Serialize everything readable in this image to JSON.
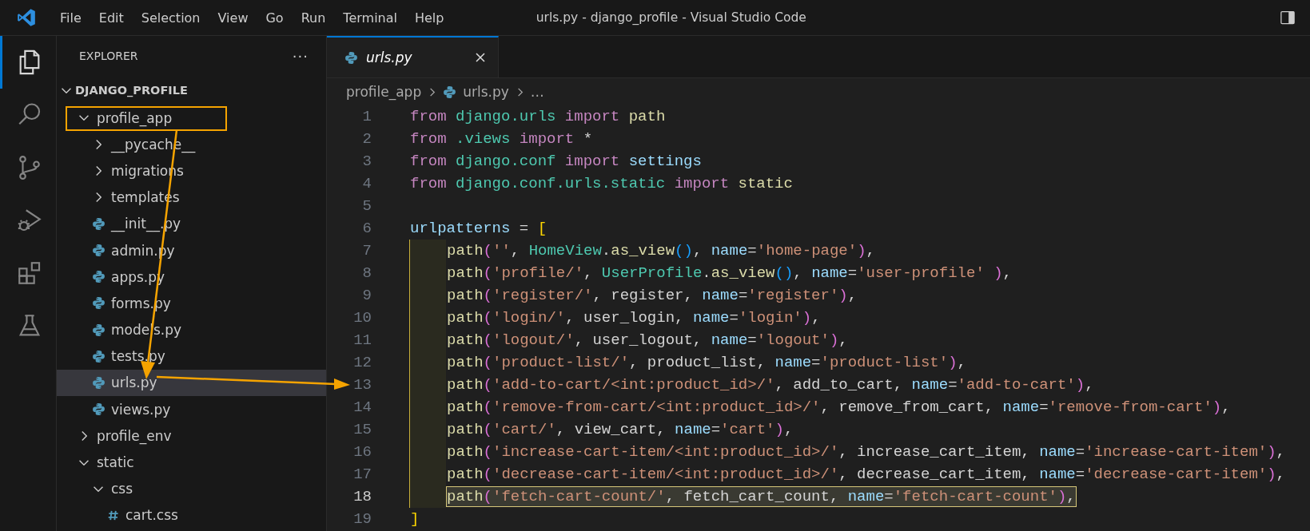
{
  "window": {
    "title": "urls.py - django_profile - Visual Studio Code"
  },
  "menu": [
    "File",
    "Edit",
    "Selection",
    "View",
    "Go",
    "Run",
    "Terminal",
    "Help"
  ],
  "activity_bar": [
    {
      "kind": "files",
      "selected": true
    },
    {
      "kind": "search",
      "selected": false
    },
    {
      "kind": "source-control",
      "selected": false
    },
    {
      "kind": "run-debug",
      "selected": false
    },
    {
      "kind": "extensions",
      "selected": false
    },
    {
      "kind": "testing",
      "selected": false
    }
  ],
  "explorer": {
    "title": "EXPLORER",
    "more": "···",
    "root": {
      "label": "DJANGO_PROFILE",
      "expanded": true
    },
    "items": [
      {
        "label": "profile_app",
        "kind": "folder",
        "expanded": true,
        "selected": false,
        "children": [
          {
            "label": "__pycache__",
            "kind": "folder",
            "expanded": false,
            "selected": false
          },
          {
            "label": "migrations",
            "kind": "folder",
            "expanded": false,
            "selected": false
          },
          {
            "label": "templates",
            "kind": "folder",
            "expanded": false,
            "selected": false
          },
          {
            "label": "__init__.py",
            "kind": "python",
            "selected": false
          },
          {
            "label": "admin.py",
            "kind": "python",
            "selected": false
          },
          {
            "label": "apps.py",
            "kind": "python",
            "selected": false
          },
          {
            "label": "forms.py",
            "kind": "python",
            "selected": false
          },
          {
            "label": "models.py",
            "kind": "python",
            "selected": false
          },
          {
            "label": "tests.py",
            "kind": "python",
            "selected": false
          },
          {
            "label": "urls.py",
            "kind": "python",
            "selected": true
          },
          {
            "label": "views.py",
            "kind": "python",
            "selected": false
          }
        ]
      },
      {
        "label": "profile_env",
        "kind": "folder",
        "expanded": false,
        "selected": false
      },
      {
        "label": "static",
        "kind": "folder",
        "expanded": true,
        "selected": false,
        "children": [
          {
            "label": "css",
            "kind": "folder",
            "expanded": true,
            "selected": false,
            "children": [
              {
                "label": "cart.css",
                "kind": "css",
                "selected": false
              }
            ]
          }
        ]
      }
    ]
  },
  "tabs": [
    {
      "label": "urls.py",
      "kind": "python",
      "selected": true
    }
  ],
  "breadcrumb": [
    {
      "label": "profile_app",
      "kind": "folder"
    },
    {
      "label": "urls.py",
      "kind": "python"
    },
    {
      "label": "…",
      "kind": "symbol"
    }
  ],
  "code_lines": [
    {
      "number": "1",
      "in_block": false,
      "selected": false,
      "tokens": [
        {
          "kind": "kw",
          "text": "from "
        },
        {
          "kind": "mod",
          "text": "django.urls "
        },
        {
          "kind": "kw",
          "text": "import "
        },
        {
          "kind": "fn",
          "text": "path"
        }
      ]
    },
    {
      "number": "2",
      "in_block": false,
      "selected": false,
      "tokens": [
        {
          "kind": "kw",
          "text": "from "
        },
        {
          "kind": "mod",
          "text": ".views "
        },
        {
          "kind": "kw",
          "text": "import "
        },
        {
          "kind": "p",
          "text": "*"
        }
      ]
    },
    {
      "number": "3",
      "in_block": false,
      "selected": false,
      "tokens": [
        {
          "kind": "kw",
          "text": "from "
        },
        {
          "kind": "mod",
          "text": "django.conf "
        },
        {
          "kind": "kw",
          "text": "import "
        },
        {
          "kind": "var",
          "text": "settings"
        }
      ]
    },
    {
      "number": "4",
      "in_block": false,
      "selected": false,
      "tokens": [
        {
          "kind": "kw",
          "text": "from "
        },
        {
          "kind": "mod",
          "text": "django.conf.urls.static "
        },
        {
          "kind": "kw",
          "text": "import "
        },
        {
          "kind": "fn",
          "text": "static"
        }
      ]
    },
    {
      "number": "5",
      "in_block": false,
      "selected": false
    },
    {
      "number": "6",
      "in_block": false,
      "selected": false,
      "tokens": [
        {
          "kind": "var",
          "text": "urlpatterns "
        },
        {
          "kind": "p",
          "text": "= "
        },
        {
          "kind": "b1",
          "text": "["
        }
      ]
    },
    {
      "number": "7",
      "in_block": true,
      "selected": false,
      "tokens": [
        {
          "kind": "fn",
          "text": "path"
        },
        {
          "kind": "b2",
          "text": "("
        },
        {
          "kind": "str",
          "text": "''"
        },
        {
          "kind": "p",
          "text": ", "
        },
        {
          "kind": "cls",
          "text": "HomeView"
        },
        {
          "kind": "p",
          "text": "."
        },
        {
          "kind": "fn",
          "text": "as_view"
        },
        {
          "kind": "b3",
          "text": "()"
        },
        {
          "kind": "p",
          "text": ", "
        },
        {
          "kind": "var",
          "text": "name"
        },
        {
          "kind": "p",
          "text": "="
        },
        {
          "kind": "str",
          "text": "'home-page'"
        },
        {
          "kind": "b2",
          "text": ")"
        },
        {
          "kind": "p",
          "text": ","
        }
      ]
    },
    {
      "number": "8",
      "in_block": true,
      "selected": false,
      "tokens": [
        {
          "kind": "fn",
          "text": "path"
        },
        {
          "kind": "b2",
          "text": "("
        },
        {
          "kind": "str",
          "text": "'profile/'"
        },
        {
          "kind": "p",
          "text": ", "
        },
        {
          "kind": "cls",
          "text": "UserProfile"
        },
        {
          "kind": "p",
          "text": "."
        },
        {
          "kind": "fn",
          "text": "as_view"
        },
        {
          "kind": "b3",
          "text": "()"
        },
        {
          "kind": "p",
          "text": ", "
        },
        {
          "kind": "var",
          "text": "name"
        },
        {
          "kind": "p",
          "text": "="
        },
        {
          "kind": "str",
          "text": "'user-profile' "
        },
        {
          "kind": "b2",
          "text": ")"
        },
        {
          "kind": "p",
          "text": ","
        }
      ]
    },
    {
      "number": "9",
      "in_block": true,
      "selected": false,
      "tokens": [
        {
          "kind": "fn",
          "text": "path"
        },
        {
          "kind": "b2",
          "text": "("
        },
        {
          "kind": "str",
          "text": "'register/'"
        },
        {
          "kind": "p",
          "text": ", register, "
        },
        {
          "kind": "var",
          "text": "name"
        },
        {
          "kind": "p",
          "text": "="
        },
        {
          "kind": "str",
          "text": "'register'"
        },
        {
          "kind": "b2",
          "text": ")"
        },
        {
          "kind": "p",
          "text": ","
        }
      ]
    },
    {
      "number": "10",
      "in_block": true,
      "selected": false,
      "tokens": [
        {
          "kind": "fn",
          "text": "path"
        },
        {
          "kind": "b2",
          "text": "("
        },
        {
          "kind": "str",
          "text": "'login/'"
        },
        {
          "kind": "p",
          "text": ", user_login, "
        },
        {
          "kind": "var",
          "text": "name"
        },
        {
          "kind": "p",
          "text": "="
        },
        {
          "kind": "str",
          "text": "'login'"
        },
        {
          "kind": "b2",
          "text": ")"
        },
        {
          "kind": "p",
          "text": ","
        }
      ]
    },
    {
      "number": "11",
      "in_block": true,
      "selected": false,
      "tokens": [
        {
          "kind": "fn",
          "text": "path"
        },
        {
          "kind": "b2",
          "text": "("
        },
        {
          "kind": "str",
          "text": "'logout/'"
        },
        {
          "kind": "p",
          "text": ", user_logout, "
        },
        {
          "kind": "var",
          "text": "name"
        },
        {
          "kind": "p",
          "text": "="
        },
        {
          "kind": "str",
          "text": "'logout'"
        },
        {
          "kind": "b2",
          "text": ")"
        },
        {
          "kind": "p",
          "text": ","
        }
      ]
    },
    {
      "number": "12",
      "in_block": true,
      "selected": false,
      "tokens": [
        {
          "kind": "fn",
          "text": "path"
        },
        {
          "kind": "b2",
          "text": "("
        },
        {
          "kind": "str",
          "text": "'product-list/'"
        },
        {
          "kind": "p",
          "text": ", product_list, "
        },
        {
          "kind": "var",
          "text": "name"
        },
        {
          "kind": "p",
          "text": "="
        },
        {
          "kind": "str",
          "text": "'product-list'"
        },
        {
          "kind": "b2",
          "text": ")"
        },
        {
          "kind": "p",
          "text": ","
        }
      ]
    },
    {
      "number": "13",
      "in_block": true,
      "selected": false,
      "tokens": [
        {
          "kind": "fn",
          "text": "path"
        },
        {
          "kind": "b2",
          "text": "("
        },
        {
          "kind": "str",
          "text": "'add-to-cart/<int:product_id>/'"
        },
        {
          "kind": "p",
          "text": ", add_to_cart, "
        },
        {
          "kind": "var",
          "text": "name"
        },
        {
          "kind": "p",
          "text": "="
        },
        {
          "kind": "str",
          "text": "'add-to-cart'"
        },
        {
          "kind": "b2",
          "text": ")"
        },
        {
          "kind": "p",
          "text": ","
        }
      ]
    },
    {
      "number": "14",
      "in_block": true,
      "selected": false,
      "tokens": [
        {
          "kind": "fn",
          "text": "path"
        },
        {
          "kind": "b2",
          "text": "("
        },
        {
          "kind": "str",
          "text": "'remove-from-cart/<int:product_id>/'"
        },
        {
          "kind": "p",
          "text": ", remove_from_cart, "
        },
        {
          "kind": "var",
          "text": "name"
        },
        {
          "kind": "p",
          "text": "="
        },
        {
          "kind": "str",
          "text": "'remove-from-cart'"
        },
        {
          "kind": "b2",
          "text": ")"
        },
        {
          "kind": "p",
          "text": ","
        }
      ]
    },
    {
      "number": "15",
      "in_block": true,
      "selected": false,
      "tokens": [
        {
          "kind": "fn",
          "text": "path"
        },
        {
          "kind": "b2",
          "text": "("
        },
        {
          "kind": "str",
          "text": "'cart/'"
        },
        {
          "kind": "p",
          "text": ", view_cart, "
        },
        {
          "kind": "var",
          "text": "name"
        },
        {
          "kind": "p",
          "text": "="
        },
        {
          "kind": "str",
          "text": "'cart'"
        },
        {
          "kind": "b2",
          "text": ")"
        },
        {
          "kind": "p",
          "text": ","
        }
      ]
    },
    {
      "number": "16",
      "in_block": true,
      "selected": false,
      "tokens": [
        {
          "kind": "fn",
          "text": "path"
        },
        {
          "kind": "b2",
          "text": "("
        },
        {
          "kind": "str",
          "text": "'increase-cart-item/<int:product_id>/'"
        },
        {
          "kind": "p",
          "text": ", increase_cart_item, "
        },
        {
          "kind": "var",
          "text": "name"
        },
        {
          "kind": "p",
          "text": "="
        },
        {
          "kind": "str",
          "text": "'increase-cart-item'"
        },
        {
          "kind": "b2",
          "text": ")"
        },
        {
          "kind": "p",
          "text": ","
        }
      ]
    },
    {
      "number": "17",
      "in_block": true,
      "selected": false,
      "tokens": [
        {
          "kind": "fn",
          "text": "path"
        },
        {
          "kind": "b2",
          "text": "("
        },
        {
          "kind": "str",
          "text": "'decrease-cart-item/<int:product_id>/'"
        },
        {
          "kind": "p",
          "text": ", decrease_cart_item, "
        },
        {
          "kind": "var",
          "text": "name"
        },
        {
          "kind": "p",
          "text": "="
        },
        {
          "kind": "str",
          "text": "'decrease-cart-item'"
        },
        {
          "kind": "b2",
          "text": ")"
        },
        {
          "kind": "p",
          "text": ","
        }
      ]
    },
    {
      "number": "18",
      "in_block": true,
      "selected": true,
      "tokens": [
        {
          "kind": "fn",
          "text": "path"
        },
        {
          "kind": "b2",
          "text": "("
        },
        {
          "kind": "str",
          "text": "'fetch-cart-count/'"
        },
        {
          "kind": "p",
          "text": ", fetch_cart_count, "
        },
        {
          "kind": "var",
          "text": "name"
        },
        {
          "kind": "p",
          "text": "="
        },
        {
          "kind": "str",
          "text": "'fetch-cart-count'"
        },
        {
          "kind": "b2",
          "text": ")"
        },
        {
          "kind": "p",
          "text": ","
        }
      ]
    },
    {
      "number": "19",
      "in_block": false,
      "selected": false,
      "tokens": [
        {
          "kind": "b1",
          "text": "]"
        }
      ]
    }
  ]
}
